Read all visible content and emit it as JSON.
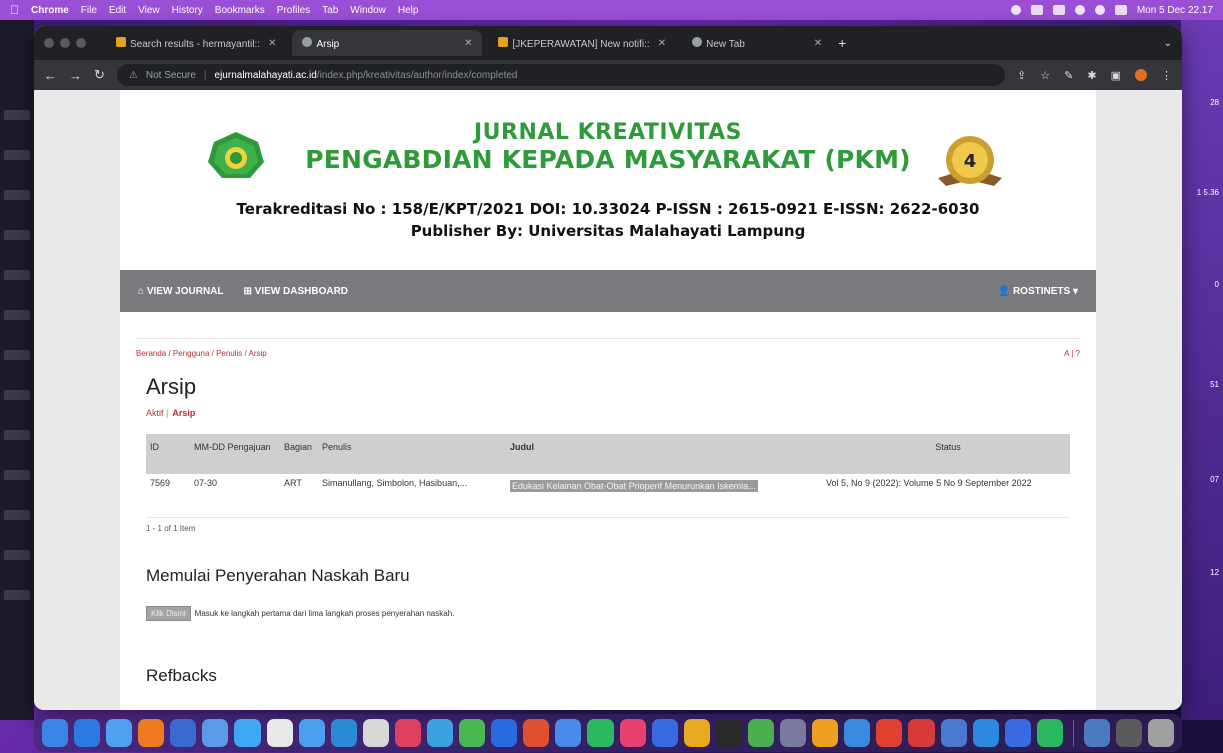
{
  "menubar": {
    "app": "Chrome",
    "items": [
      "File",
      "Edit",
      "View",
      "History",
      "Bookmarks",
      "Profiles",
      "Tab",
      "Window",
      "Help"
    ],
    "clock": "Mon 5 Dec 22.17"
  },
  "right_strip": [
    "28",
    "1 5.36",
    "0",
    "51",
    "07",
    "12"
  ],
  "tabs": [
    {
      "title": "Search results - hermayantil::",
      "active": false
    },
    {
      "title": "Arsip",
      "active": true
    },
    {
      "title": "[JKEPERAWATAN] New notifi::",
      "active": false
    },
    {
      "title": "New Tab",
      "active": false
    }
  ],
  "omnibox": {
    "security": "Not Secure",
    "host": "ejurnalmalahayati.ac.id",
    "path": "/index.php/kreativitas/author/index/completed"
  },
  "journal": {
    "title_line1": "JURNAL KREATIVITAS",
    "title_line2": "PENGABDIAN KEPADA MASYARAKAT (PKM)",
    "accreditation": "Terakreditasi No : 158/E/KPT/2021  DOI:  10.33024    P-ISSN : 2615-0921    E-ISSN: 2622-6030",
    "publisher": "Publisher By: Universitas Malahayati Lampung",
    "badge_number": "4",
    "colors": {
      "title_green": "#2f9a3a",
      "navbar": "#797a7d",
      "link_red": "#b0303a"
    }
  },
  "navbar": {
    "view_journal": "VIEW JOURNAL",
    "view_dashboard": "VIEW DASHBOARD",
    "user": "ROSTINETS"
  },
  "breadcrumb": {
    "path": "Beranda / Pengguna / Penulis / Arsip",
    "help": "A | ?"
  },
  "page": {
    "title": "Arsip",
    "subnav_active": "Aktif",
    "subnav_current": "Arsip"
  },
  "table": {
    "headers": {
      "id": "ID",
      "date": "MM-DD Pengajuan",
      "section": "Bagian",
      "authors": "Penulis",
      "title": "Judul",
      "status": "Status"
    },
    "rows": [
      {
        "id": "7569",
        "date": "07-30",
        "section": "ART",
        "authors": "Simanullang, Simbolon, Hasibuan,...",
        "title": "Edukasi Kelainan Obat-Obat Prioperif Menurunkan Iskemia...",
        "status": "Vol 5, No 9 (2022): Volume 5 No 9 September 2022"
      }
    ],
    "count": "1 - 1 of 1 Item"
  },
  "new_submission": {
    "heading": "Memulai Penyerahan Naskah Baru",
    "button": "Klik Disini",
    "text": "Masuk ke langkah pertama dari lima langkah proses penyerahan naskah."
  },
  "refbacks": {
    "heading": "Refbacks"
  },
  "dock_colors": [
    "#3a86e8",
    "#2a7ae0",
    "#4ea0f0",
    "#f07a20",
    "#3a6ad0",
    "#5a9ae8",
    "#3fa8f5",
    "#e8e8e8",
    "#4a9ef0",
    "#2a8ad8",
    "#d8d8d8",
    "#e04060",
    "#3aa0e0",
    "#4ab850",
    "#2a6ae0",
    "#e05030",
    "#4a8ae8",
    "#2ab860",
    "#e84070",
    "#3a6ae0",
    "#e8a820",
    "#2a2a2a",
    "#4ab050",
    "#7a7aa0",
    "#f0a020",
    "#3a8ae0",
    "#e04030",
    "#d83a3a",
    "#4a7ad0",
    "#2a8ae0",
    "#3a6ae0",
    "#2ab860",
    "#4a7ac0",
    "#5a5a5a",
    "#a0a0a0"
  ]
}
